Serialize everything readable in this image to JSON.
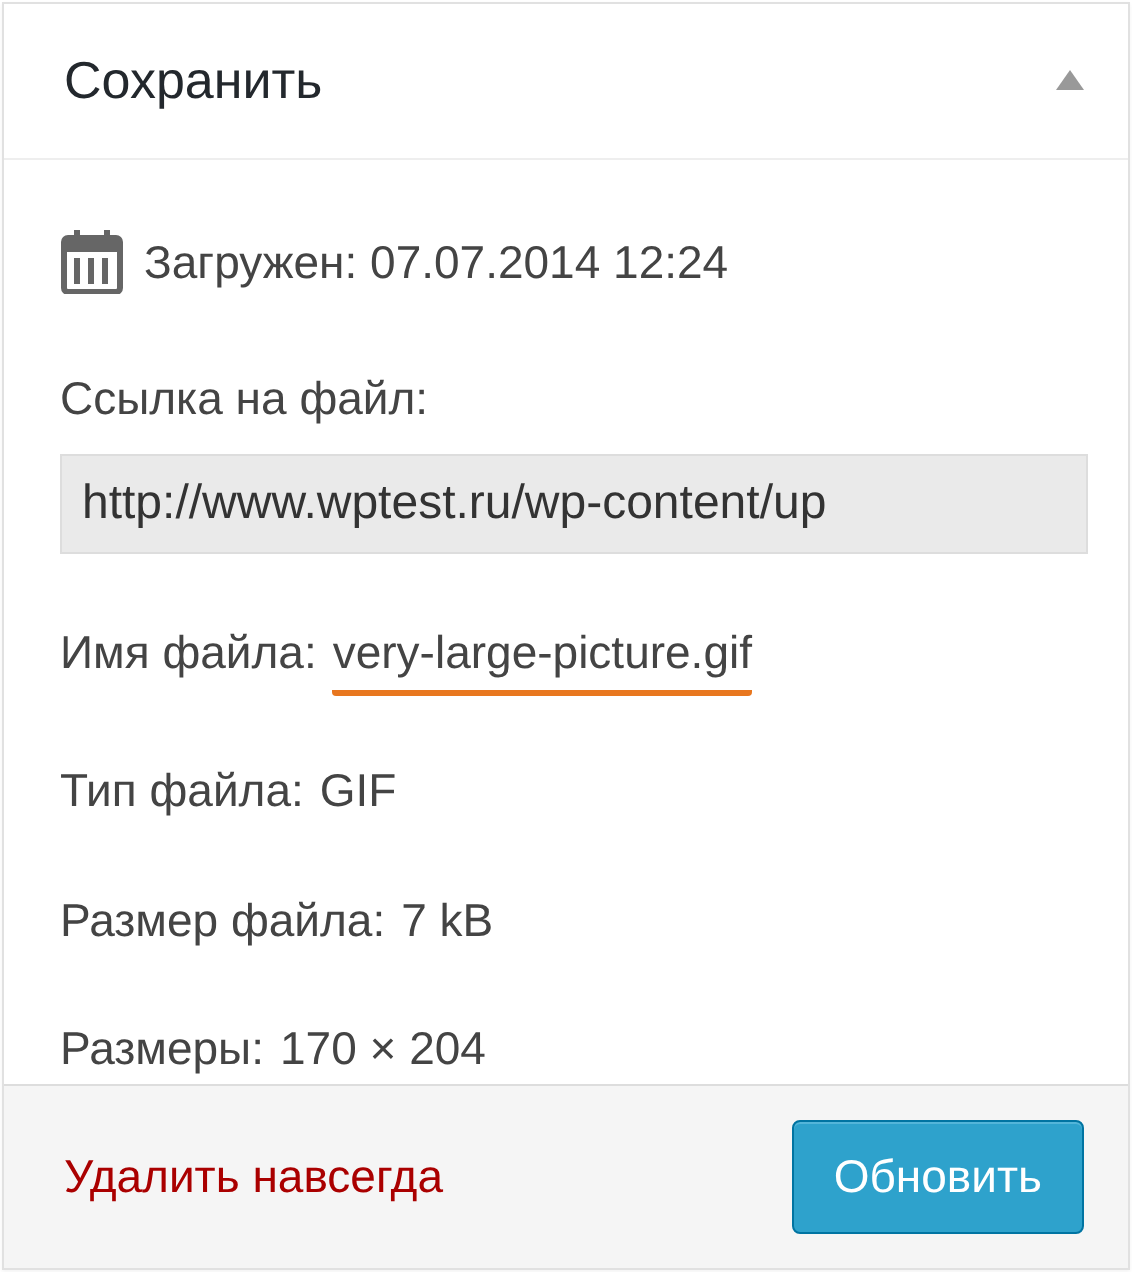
{
  "panel": {
    "title": "Сохранить",
    "expanded": true
  },
  "uploaded": {
    "label": "Загружен:",
    "value": "07.07.2014 12:24"
  },
  "file_url": {
    "label": "Ссылка на файл:",
    "value": "http://www.wptest.ru/wp-content/up"
  },
  "details": [
    {
      "label": "Имя файла:",
      "value": "very-large-picture.gif",
      "underlined": true
    },
    {
      "label": "Тип файла:",
      "value": "GIF",
      "underlined": false
    },
    {
      "label": "Размер файла:",
      "value": "7 kB",
      "underlined": false
    },
    {
      "label": "Размеры:",
      "value": "170 × 204",
      "underlined": false
    }
  ],
  "footer": {
    "delete_link": "Удалить навсегда",
    "update_button": "Обновить"
  }
}
